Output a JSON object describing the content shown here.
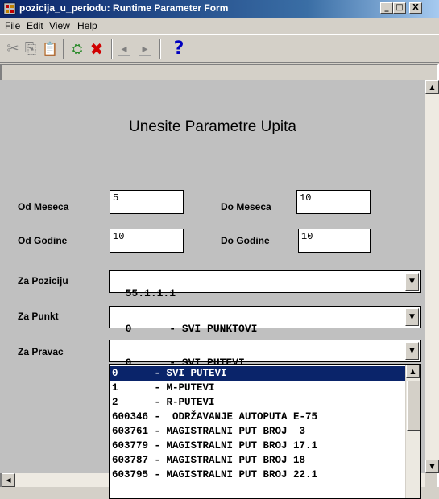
{
  "window": {
    "title": "pozicija_u_periodu: Runtime Parameter Form",
    "minimize": "_",
    "maximize": "□",
    "close": "X"
  },
  "menu": [
    "File",
    "Edit",
    "View",
    "Help"
  ],
  "toolbar": {
    "cut": "✂",
    "copy": "⎘",
    "paste": "📋",
    "run": "⛭",
    "cancel": "✖",
    "prev": "◂",
    "next": "▸",
    "help": "?"
  },
  "form": {
    "title": "Unesite Parametre Upita",
    "od_meseca": {
      "label": "Od Meseca",
      "value": "5"
    },
    "do_meseca": {
      "label": "Do Meseca",
      "value": "10"
    },
    "od_godine": {
      "label": "Od Godine",
      "value": "10"
    },
    "do_godine": {
      "label": "Do Godine",
      "value": "10"
    },
    "za_poziciju": {
      "label": "Za Poziciju",
      "value": "55.1.1.1"
    },
    "za_punkt": {
      "label": "Za Punkt",
      "value": "0      - SVI PUNKTOVI"
    },
    "za_pravac": {
      "label": "Za Pravac",
      "value": "0      - SVI PUTEVI"
    }
  },
  "dropdown": {
    "items": [
      "0      - SVI PUTEVI",
      "1      - M-PUTEVI",
      "2      - R-PUTEVI",
      "600346 -  ODRŽAVANJE AUTOPUTA E-75",
      "603761 - MAGISTRALNI PUT BROJ  3",
      "603779 - MAGISTRALNI PUT BROJ 17.1",
      "603787 - MAGISTRALNI PUT BROJ 18",
      "603795 - MAGISTRALNI PUT BROJ 22.1"
    ],
    "selected_index": 0
  },
  "colors": {
    "selection": "#0a246a",
    "title_bar": "#0a246a",
    "form_bg": "#c0c0c0"
  }
}
